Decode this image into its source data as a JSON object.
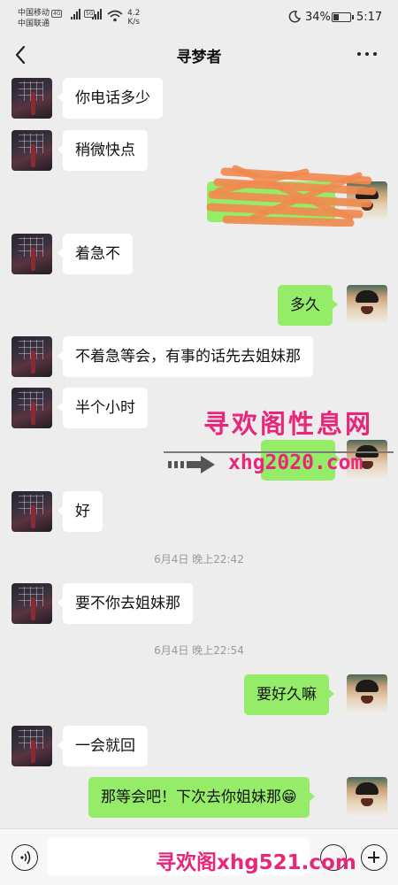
{
  "status_bar": {
    "carrier_1": "中国移动",
    "carrier_2": "中国联通",
    "net_1": "4G",
    "net_2": "5G",
    "speed_value": "4.2",
    "speed_unit": "K/s",
    "battery": "34%",
    "time": "5:17",
    "battery_level": 0.34
  },
  "header": {
    "title": "寻梦者",
    "back_icon": "chevron-left-icon",
    "more_icon": "more-dots-icon"
  },
  "messages": [
    {
      "sender": "other",
      "text": "你电话多少"
    },
    {
      "sender": "other",
      "text": "稍微快点"
    },
    {
      "sender": "me",
      "text": "",
      "redacted": true
    },
    {
      "sender": "other",
      "text": "着急不"
    },
    {
      "sender": "me",
      "text": "多久"
    },
    {
      "sender": "other",
      "text": "不着急等会，有事的话先去姐妹那"
    },
    {
      "sender": "other",
      "text": "半个小时"
    },
    {
      "sender": "me",
      "text": ""
    },
    {
      "sender": "other",
      "text": "好"
    },
    {
      "type": "time",
      "text": "6月4日 晚上22:42"
    },
    {
      "sender": "other",
      "text": "要不你去姐妹那"
    },
    {
      "type": "time",
      "text": "6月4日 晚上22:54"
    },
    {
      "sender": "me",
      "text": "要好久嘛"
    },
    {
      "sender": "other",
      "text": "一会就回"
    },
    {
      "sender": "me",
      "text": "那等会吧！下次去你姐妹那😁"
    }
  ],
  "watermark": {
    "title": "寻欢阁性息网",
    "url": "xhg2020.com",
    "bottom": "寻欢阁xhg521.com",
    "color": "#e8277a"
  },
  "input_bar": {
    "voice_icon": "voice-icon",
    "emoji_icon": "emoji-icon",
    "plus_icon": "plus-icon"
  },
  "colors": {
    "background": "#ededed",
    "bubble_me": "#95ec69",
    "bubble_other": "#ffffff"
  }
}
